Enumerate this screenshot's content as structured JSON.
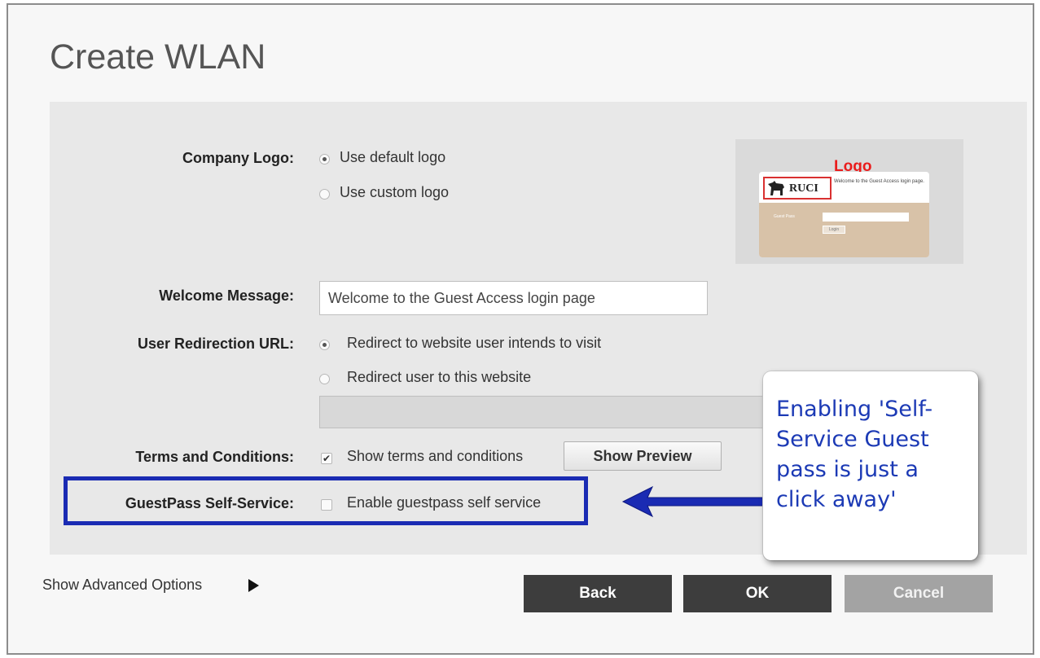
{
  "dialog": {
    "title": "Create WLAN"
  },
  "company_logo": {
    "label": "Company Logo:",
    "options": [
      "Use default logo",
      "Use custom logo"
    ],
    "selected": 0,
    "preview": {
      "caption": "Logo",
      "brand_text": "RUCI",
      "welcome_text": "Welcome to the Guest Access login page.",
      "user_pass_label": "Guest Pass",
      "login_button": "Login"
    }
  },
  "welcome_message": {
    "label": "Welcome Message:",
    "value": "Welcome to the Guest Access login page"
  },
  "redirection": {
    "label": "User Redirection URL:",
    "options": [
      "Redirect to website user intends to visit",
      "Redirect user to this website"
    ],
    "selected": 0,
    "url_value": ""
  },
  "terms": {
    "label": "Terms and Conditions:",
    "checkbox_label": "Show terms and conditions",
    "checked": true,
    "preview_button": "Show Preview"
  },
  "guestpass": {
    "label": "GuestPass Self-Service:",
    "checkbox_label": "Enable guestpass self service",
    "checked": false
  },
  "callout": {
    "text": "Enabling 'Self-Service Guest pass is just a click away'"
  },
  "advanced": {
    "label": "Show Advanced Options"
  },
  "buttons": {
    "back": "Back",
    "ok": "OK",
    "cancel": "Cancel"
  },
  "colors": {
    "highlight_border": "#1a2bb3",
    "callout_text": "#1c3ab5",
    "logo_caption": "#ea1c1c"
  }
}
